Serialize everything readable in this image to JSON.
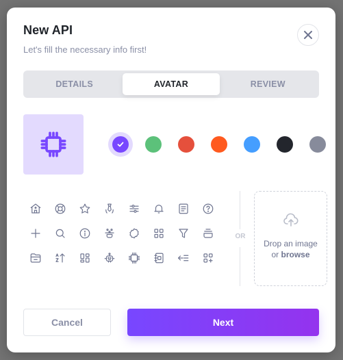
{
  "modal": {
    "title": "New API",
    "subtitle": "Let's fill the necessary info first!",
    "close_icon": "close-icon"
  },
  "tabs": [
    {
      "label": "DETAILS",
      "active": false
    },
    {
      "label": "AVATAR",
      "active": true
    },
    {
      "label": "REVIEW",
      "active": false
    }
  ],
  "avatar": {
    "selected_icon": "cpu-icon",
    "selected_color": "#7847ff",
    "preview_background": "#e3dafe"
  },
  "colors": [
    {
      "name": "purple",
      "hex": "#7847ff",
      "selected": true
    },
    {
      "name": "green",
      "hex": "#5cc17a",
      "selected": false
    },
    {
      "name": "red",
      "hex": "#e5503c",
      "selected": false
    },
    {
      "name": "orange",
      "hex": "#ff5a1f",
      "selected": false
    },
    {
      "name": "blue",
      "hex": "#459eff",
      "selected": false
    },
    {
      "name": "black",
      "hex": "#23262d",
      "selected": false
    },
    {
      "name": "gray",
      "hex": "#878b9b",
      "selected": false
    }
  ],
  "icons": [
    "home-icon",
    "lifebuoy-icon",
    "star-icon",
    "tie-icon",
    "sliders-icon",
    "bell-icon",
    "document-icon",
    "help-circle-icon",
    "plus-icon",
    "search-icon",
    "info-icon",
    "users-group-icon",
    "badge-icon",
    "grid-icon",
    "filter-icon",
    "archive-icon",
    "folder-icon",
    "sort-az-icon",
    "dashboard-icon",
    "robot-icon",
    "cpu-icon",
    "notebook-icon",
    "collapse-left-icon",
    "grid-plus-icon"
  ],
  "divider_label": "OR",
  "dropzone": {
    "line1": "Drop an image",
    "line2_prefix": "or ",
    "line2_link": "browse"
  },
  "footer": {
    "cancel_label": "Cancel",
    "next_label": "Next"
  }
}
